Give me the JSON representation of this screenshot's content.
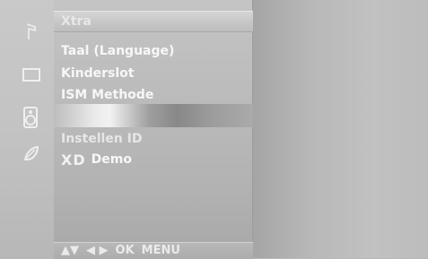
{
  "menu": {
    "title": "Xtra",
    "items": [
      {
        "label": "Taal (Language)"
      },
      {
        "label": "Kinderslot"
      },
      {
        "label": "ISM Methode"
      },
      {
        "label": ""
      },
      {
        "label": "Instellen ID"
      }
    ],
    "xd_logo": "XD",
    "xd_demo_label": "Demo"
  },
  "sidebar": {
    "icons": [
      "music-note-icon",
      "screen-icon",
      "speaker-icon",
      "leaf-icon"
    ]
  },
  "footer": {
    "up_down": "▲▼",
    "left_right": "◀ ▶",
    "ok": "OK",
    "menu": "MENU"
  }
}
